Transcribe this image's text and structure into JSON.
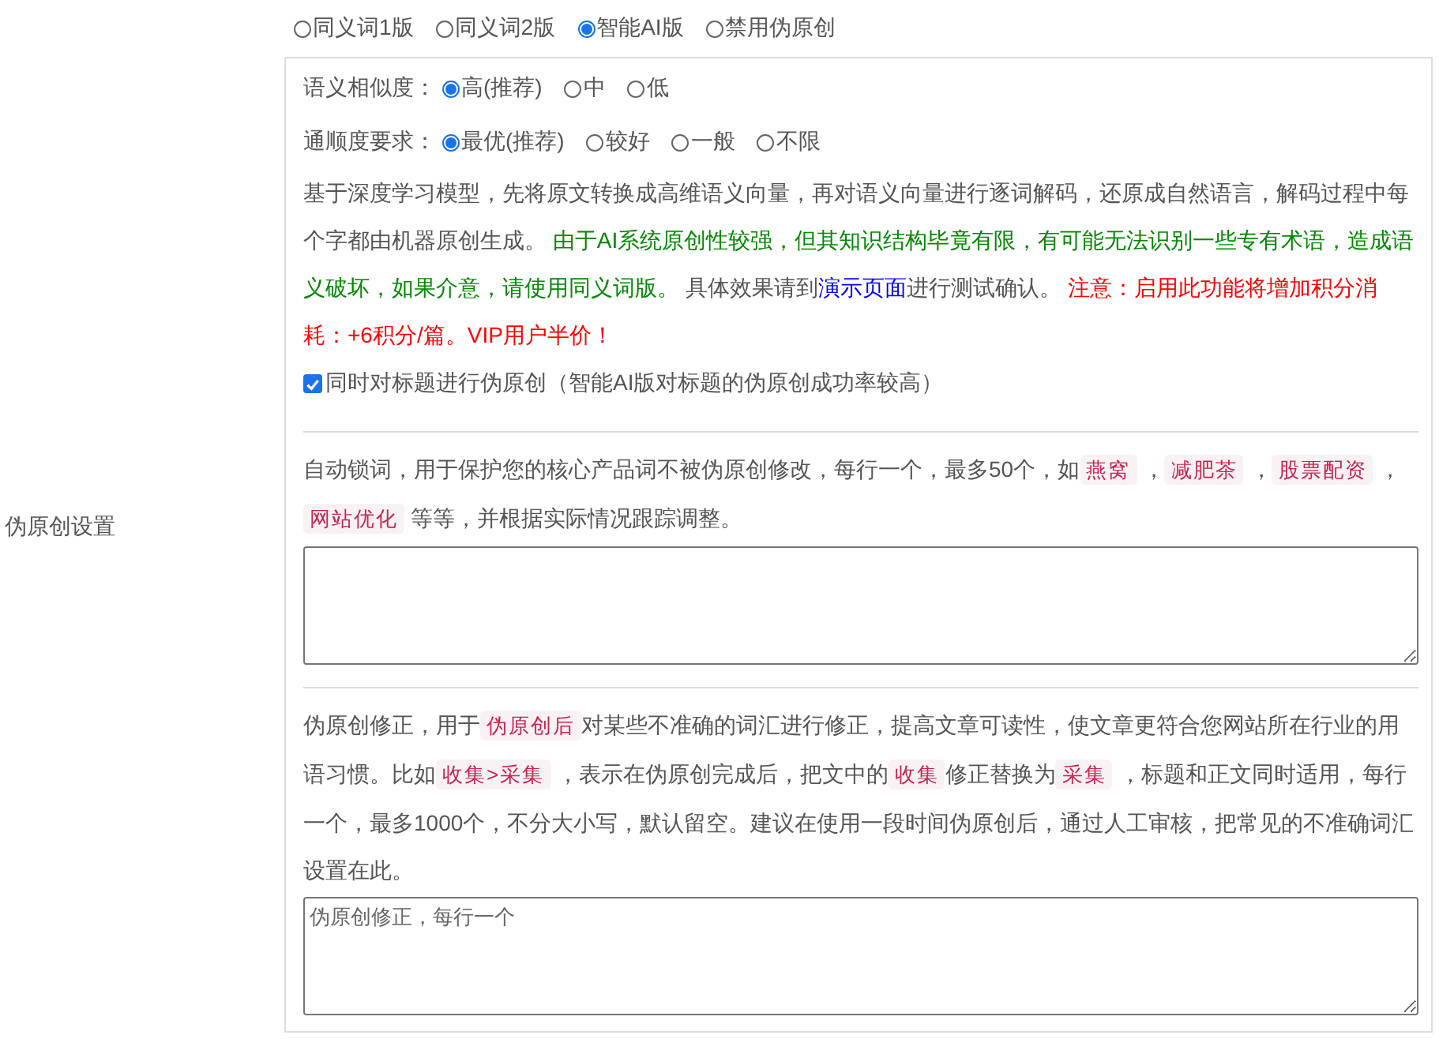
{
  "sidebar_label": "伪原创设置",
  "modes": [
    {
      "label": "同义词1版",
      "selected": false
    },
    {
      "label": "同义词2版",
      "selected": false
    },
    {
      "label": "智能AI版",
      "selected": true
    },
    {
      "label": "禁用伪原创",
      "selected": false
    }
  ],
  "ai_settings": {
    "option_groups": [
      {
        "label": "语义相似度：",
        "options": [
          {
            "label": "高(推荐)",
            "selected": true
          },
          {
            "label": "中",
            "selected": false
          },
          {
            "label": "低",
            "selected": false
          }
        ]
      },
      {
        "label": "通顺度要求：",
        "options": [
          {
            "label": "最优(推荐)",
            "selected": true
          },
          {
            "label": "较好",
            "selected": false
          },
          {
            "label": "一般",
            "selected": false
          },
          {
            "label": "不限",
            "selected": false
          }
        ]
      }
    ],
    "description": [
      {
        "kind": "text",
        "text": "基于深度学习模型，先将原文转换成高维语义向量，再对语义向量进行逐词解码，还原成自然语言，解码过程中每个字都由机器原创生成。 "
      },
      {
        "kind": "good",
        "text": "由于AI系统原创性较强，但其知识结构毕竟有限，有可能无法识别一些专有术语，造成语义破坏，如果介意，请使用同义词版。"
      },
      {
        "kind": "text",
        "text": " 具体效果请到"
      },
      {
        "kind": "link",
        "text": "演示页面"
      },
      {
        "kind": "text",
        "text": "进行测试确认。 "
      },
      {
        "kind": "warn",
        "text": "注意：启用此功能将增加积分消耗：+6积分/篇。VIP用户半价！"
      }
    ],
    "title_checkbox": {
      "label": "同时对标题进行伪原创（智能AI版对标题的伪原创成功率较高）",
      "checked": true
    }
  },
  "lock_words": {
    "description": [
      {
        "kind": "text",
        "text": "自动锁词，用于保护您的核心产品词不被伪原创修改，每行一个，最多50个，如"
      },
      {
        "kind": "code",
        "text": "燕窝"
      },
      {
        "kind": "text",
        "text": " ，"
      },
      {
        "kind": "code",
        "text": "减肥茶"
      },
      {
        "kind": "text",
        "text": " ，"
      },
      {
        "kind": "code",
        "text": "股票配资"
      },
      {
        "kind": "text",
        "text": " ，"
      },
      {
        "kind": "code",
        "text": "网站优化"
      },
      {
        "kind": "text",
        "text": " 等等，并根据实际情况跟踪调整。"
      }
    ]
  },
  "corrections": {
    "description": [
      {
        "kind": "text",
        "text": "伪原创修正，用于"
      },
      {
        "kind": "code",
        "text": "伪原创后"
      },
      {
        "kind": "text",
        "text": "对某些不准确的词汇进行修正，提高文章可读性，使文章更符合您网站所在行业的用语习惯。比如"
      },
      {
        "kind": "code",
        "text": "收集>采集"
      },
      {
        "kind": "text",
        "text": " ，表示在伪原创完成后，把文中的"
      },
      {
        "kind": "code",
        "text": "收集"
      },
      {
        "kind": "text",
        "text": "修正替换为"
      },
      {
        "kind": "code",
        "text": "采集"
      },
      {
        "kind": "text",
        "text": " ，标题和正文同时适用，每行一个，最多1000个，不分大小写，默认留空。建议在使用一段时间伪原创后，通过人工审核，把常见的不准确词汇设置在此。"
      }
    ],
    "placeholder": "伪原创修正，每行一个"
  }
}
